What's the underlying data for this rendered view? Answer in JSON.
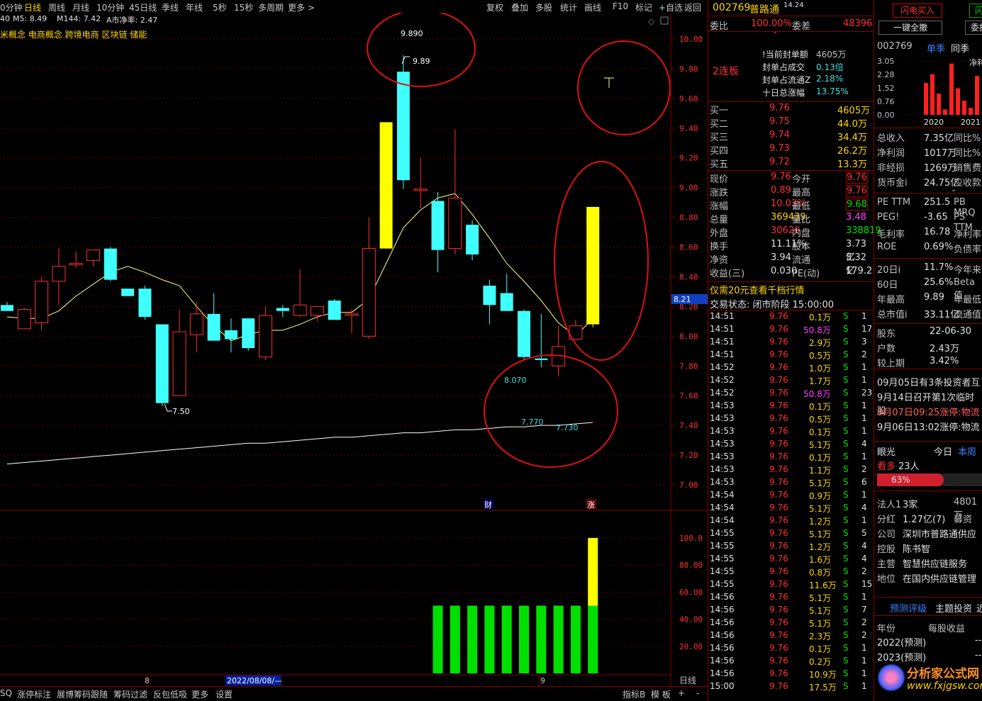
{
  "toolbar": {
    "periods": [
      "0分钟",
      "日线",
      "周线",
      "月线",
      "10分钟",
      "45日线",
      "季线",
      "年线",
      "5秒",
      "15秒",
      "多周期",
      "更多 >"
    ],
    "active": "日线",
    "right_tools": [
      "复权",
      "叠加",
      "多股",
      "统计",
      "画线",
      "F10",
      "标记",
      "+自选",
      "返回"
    ]
  },
  "indicator_line": {
    "prefix": "40",
    "ma5": "M5: 8.49",
    "ma144": "M144: 7.42",
    "net": "A市净率: 2.47"
  },
  "concepts": "米概念 电商概念 跨境电商 区块链 储能",
  "annotations": {
    "high_label": "9.890",
    "high_mark": "9.89",
    "low_mark": "7.50",
    "support_a": "8.070",
    "support_b": "7.770",
    "support_c": "7.730",
    "cur_price": "8.21",
    "event_fin": "财",
    "event_up": "涨"
  },
  "x_labels": [
    "8",
    "2022/08/08/—",
    "9"
  ],
  "right_axis_label": "日线",
  "chart_data": [
    {
      "type": "candlestick",
      "title": "",
      "ylim": [
        6.9,
        10.1
      ],
      "y_ticks": [
        "10.00",
        "9.80",
        "9.60",
        "9.40",
        "9.20",
        "9.00",
        "8.80",
        "8.60",
        "8.40",
        "8.20",
        "8.00",
        "7.80",
        "7.60",
        "7.40",
        "7.20",
        "7.00"
      ],
      "candles": [
        {
          "o": 8.21,
          "h": 8.23,
          "l": 8.17,
          "c": 8.17
        },
        {
          "o": 8.05,
          "h": 8.19,
          "l": 8.05,
          "c": 8.18
        },
        {
          "o": 8.09,
          "h": 8.4,
          "l": 8.04,
          "c": 8.37
        },
        {
          "o": 8.37,
          "h": 8.59,
          "l": 8.21,
          "c": 8.47
        },
        {
          "o": 8.48,
          "h": 8.57,
          "l": 8.46,
          "c": 8.49
        },
        {
          "o": 8.51,
          "h": 8.58,
          "l": 8.47,
          "c": 8.58
        },
        {
          "o": 8.59,
          "h": 8.6,
          "l": 8.37,
          "c": 8.38
        },
        {
          "o": 8.32,
          "h": 8.32,
          "l": 8.27,
          "c": 8.27
        },
        {
          "o": 8.32,
          "h": 8.34,
          "l": 8.11,
          "c": 8.13
        },
        {
          "o": 8.08,
          "h": 8.08,
          "l": 7.53,
          "c": 7.55
        },
        {
          "o": 7.6,
          "h": 8.18,
          "l": 7.6,
          "c": 8.03
        },
        {
          "o": 8.01,
          "h": 8.23,
          "l": 7.89,
          "c": 8.15
        },
        {
          "o": 8.15,
          "h": 8.29,
          "l": 7.98,
          "c": 7.97
        },
        {
          "o": 8.04,
          "h": 8.12,
          "l": 7.89,
          "c": 7.98
        },
        {
          "o": 8.12,
          "h": 8.12,
          "l": 7.9,
          "c": 7.92
        },
        {
          "o": 7.86,
          "h": 8.2,
          "l": 7.84,
          "c": 8.14
        },
        {
          "o": 8.19,
          "h": 8.21,
          "l": 8.13,
          "c": 8.17
        },
        {
          "o": 8.14,
          "h": 8.45,
          "l": 8.13,
          "c": 8.21
        },
        {
          "o": 8.14,
          "h": 8.17,
          "l": 8.1,
          "c": 8.2
        },
        {
          "o": 8.24,
          "h": 8.25,
          "l": 8.12,
          "c": 8.11
        },
        {
          "o": 8.15,
          "h": 8.18,
          "l": 8.02,
          "c": 8.15
        },
        {
          "o": 8.0,
          "h": 8.8,
          "l": 7.98,
          "c": 8.59
        },
        {
          "o": 8.59,
          "h": 9.44,
          "l": 8.59,
          "c": 9.44,
          "limit": true
        },
        {
          "o": 9.78,
          "h": 9.89,
          "l": 8.99,
          "c": 9.05
        },
        {
          "o": 8.99,
          "h": 9.2,
          "l": 8.86,
          "c": 8.99
        },
        {
          "o": 8.91,
          "h": 8.97,
          "l": 8.43,
          "c": 8.58
        },
        {
          "o": 8.59,
          "h": 9.39,
          "l": 8.55,
          "c": 8.93
        },
        {
          "o": 8.75,
          "h": 8.78,
          "l": 8.51,
          "c": 8.55
        },
        {
          "o": 8.34,
          "h": 8.38,
          "l": 8.08,
          "c": 8.21
        },
        {
          "o": 8.29,
          "h": 8.42,
          "l": 8.17,
          "c": 8.17
        },
        {
          "o": 8.17,
          "h": 8.18,
          "l": 7.84,
          "c": 7.86
        },
        {
          "o": 7.85,
          "h": 8.15,
          "l": 7.79,
          "c": 7.84
        },
        {
          "o": 7.8,
          "h": 8.07,
          "l": 7.73,
          "c": 7.93
        },
        {
          "o": 7.98,
          "h": 8.11,
          "l": 7.99,
          "c": 8.07
        },
        {
          "o": 8.08,
          "h": 8.87,
          "l": 8.06,
          "c": 8.87,
          "limit": true
        }
      ],
      "ma5": [
        8.13,
        8.12,
        8.12,
        8.17,
        8.27,
        8.35,
        8.43,
        8.47,
        8.43,
        8.38,
        8.34,
        8.2,
        8.07,
        7.97,
        8.01,
        8.04,
        8.04,
        8.08,
        8.13,
        8.16,
        8.16,
        8.25,
        8.49,
        8.73,
        8.85,
        8.93,
        8.96,
        8.82,
        8.66,
        8.49,
        8.37,
        8.24,
        8.09,
        8.0,
        8.12
      ],
      "ma144": [
        7.14,
        7.15,
        7.16,
        7.17,
        7.18,
        7.19,
        7.2,
        7.21,
        7.22,
        7.23,
        7.24,
        7.25,
        7.26,
        7.27,
        7.28,
        7.28,
        7.29,
        7.3,
        7.31,
        7.32,
        7.32,
        7.33,
        7.34,
        7.35,
        7.35,
        7.36,
        7.37,
        7.37,
        7.38,
        7.39,
        7.39,
        7.4,
        7.4,
        7.41,
        7.42
      ]
    },
    {
      "type": "bar",
      "title": "",
      "ylim": [
        0,
        110
      ],
      "y_ticks": [
        "100.0",
        "80.00",
        "60.00",
        "40.00",
        "20.00"
      ],
      "values": [
        0,
        0,
        0,
        0,
        0,
        0,
        0,
        0,
        0,
        0,
        0,
        0,
        0,
        0,
        0,
        0,
        0,
        0,
        0,
        0,
        0,
        0,
        0,
        0,
        0,
        50,
        50,
        50,
        50,
        50,
        50,
        50,
        50,
        50,
        100
      ],
      "highlight_last": true
    },
    {
      "type": "bar",
      "title": "",
      "categories": [
        "2020",
        "2021"
      ],
      "y_ticks": [
        "3.05",
        "2.28",
        "1.52",
        "0.76",
        "0.00"
      ],
      "values": [
        1.8,
        2.3,
        1.2,
        0.3,
        2.9,
        1.5,
        0.8,
        0.4,
        2.2
      ]
    }
  ],
  "quote": {
    "code": "002769",
    "name": "普路通",
    "superscript": "14.24",
    "wb_label": "委比",
    "wb": "100.00%",
    "wc_label": "委差",
    "wc": "48396",
    "streak": "2连板",
    "seal": [
      {
        "k": "!当前封单额",
        "v": "4605万"
      },
      {
        "k": "封单占成交",
        "v": "0.13倍"
      },
      {
        "k": "封单占流通Z",
        "v": "2.18%"
      },
      {
        "k": "十日总涨幅",
        "v": "13.75%"
      }
    ],
    "bids": [
      {
        "k": "买一",
        "p": "9.76",
        "v": "4605万"
      },
      {
        "k": "买二",
        "p": "9.75",
        "v": "44.0万"
      },
      {
        "k": "买三",
        "p": "9.74",
        "v": "34.4万"
      },
      {
        "k": "买四",
        "p": "9.73",
        "v": "26.2万"
      },
      {
        "k": "买五",
        "p": "9.72",
        "v": "13.3万"
      }
    ],
    "stats": [
      {
        "k1": "现价",
        "v1": "9.76",
        "k2": "今开",
        "v2": "9.76"
      },
      {
        "k1": "涨跌",
        "v1": "0.89",
        "k2": "最高",
        "v2": "9.76"
      },
      {
        "k1": "涨幅",
        "v1": "10.03%",
        "k2": "最低",
        "v2": "9.68"
      },
      {
        "k1": "总量",
        "v1": "369439",
        "k2": "量比",
        "v2": "3.48"
      },
      {
        "k1": "外盘",
        "v1": "30620",
        "k2": "内盘",
        "v2": "338819"
      },
      {
        "k1": "换手",
        "v1": "11.11%",
        "k2": "股本",
        "v2": "3.73亿"
      },
      {
        "k1": "净资",
        "v1": "3.94",
        "k2": "流通",
        "v2": "3.32亿"
      },
      {
        "k1": "收益(三)",
        "v1": "0.030",
        "k2": "PE(动)",
        "v2": "179.2"
      }
    ],
    "promo": "仅需20元查看千档行情",
    "status": "交易状态: 闭市阶段 15:00:00",
    "ticks": [
      [
        "14:51",
        "9.76",
        "0.1万",
        "S",
        "1"
      ],
      [
        "14:51",
        "9.76",
        "50.8万",
        "S",
        "17"
      ],
      [
        "14:51",
        "9.76",
        "2.9万",
        "S",
        "3"
      ],
      [
        "14:51",
        "9.76",
        "0.5万",
        "S",
        "2"
      ],
      [
        "14:52",
        "9.76",
        "1.0万",
        "S",
        "1"
      ],
      [
        "14:52",
        "9.76",
        "1.7万",
        "S",
        "1"
      ],
      [
        "14:52",
        "9.76",
        "50.8万",
        "S",
        "23"
      ],
      [
        "14:53",
        "9.76",
        "0.1万",
        "S",
        "1"
      ],
      [
        "14:53",
        "9.76",
        "0.5万",
        "S",
        "1"
      ],
      [
        "14:53",
        "9.76",
        "0.1万",
        "S",
        "1"
      ],
      [
        "14:53",
        "9.76",
        "5.1万",
        "S",
        "4"
      ],
      [
        "14:53",
        "9.76",
        "0.1万",
        "S",
        "1"
      ],
      [
        "14:53",
        "9.76",
        "1.1万",
        "S",
        "2"
      ],
      [
        "14:53",
        "9.76",
        "5.1万",
        "S",
        "6"
      ],
      [
        "14:54",
        "9.76",
        "0.9万",
        "S",
        "1"
      ],
      [
        "14:54",
        "9.76",
        "5.1万",
        "S",
        "4"
      ],
      [
        "14:54",
        "9.76",
        "1.2万",
        "S",
        "1"
      ],
      [
        "14:55",
        "9.76",
        "5.1万",
        "S",
        "5"
      ],
      [
        "14:55",
        "9.76",
        "1.2万",
        "S",
        "4"
      ],
      [
        "14:55",
        "9.76",
        "1.6万",
        "S",
        "4"
      ],
      [
        "14:55",
        "9.76",
        "0.8万",
        "S",
        "2"
      ],
      [
        "14:55",
        "9.76",
        "11.6万",
        "S",
        "15"
      ],
      [
        "14:56",
        "9.76",
        "5.1万",
        "S",
        "1"
      ],
      [
        "14:56",
        "9.76",
        "5.1万",
        "S",
        "7"
      ],
      [
        "14:56",
        "9.76",
        "5.1万",
        "S",
        "2"
      ],
      [
        "14:56",
        "9.76",
        "2.3万",
        "S",
        "2"
      ],
      [
        "14:56",
        "9.76",
        "0.1万",
        "S",
        "1"
      ],
      [
        "14:56",
        "9.76",
        "0.2万",
        "S",
        "1"
      ],
      [
        "14:56",
        "9.76",
        "10.9万",
        "S",
        "1"
      ],
      [
        "15:00",
        "9.76",
        "17.5万",
        "S",
        "1"
      ]
    ]
  },
  "fin": {
    "btn_flash_buy": "闪电买入",
    "btn_flash_sell": "闪电",
    "btn_cancel_all": "一键全撤",
    "btn_order": "委托",
    "code": "002769",
    "tab_q": "单季",
    "tab_yoy": "同季",
    "netprofit": "净利",
    "rows1": [
      {
        "k": "总收入",
        "v": "7.35亿",
        "x": "同比%"
      },
      {
        "k": "净利润",
        "v": "1017万",
        "x": "同比%"
      },
      {
        "k": "非经损",
        "v": "1269万",
        "x": "销售费"
      },
      {
        "k": "货币金i",
        "v": "24.75亿",
        "x": "应收款"
      }
    ],
    "rows2": [
      {
        "k": "PE TTM",
        "v": "251.5",
        "x": "PB MRQ"
      },
      {
        "k": "PEG!",
        "v": "-3.65",
        "x": "PS TTM"
      },
      {
        "k": "毛利率",
        "v": "16.78",
        "x": "净利率"
      },
      {
        "k": "ROE",
        "v": "0.69%",
        "x": "负债率"
      }
    ],
    "rows3": [
      {
        "k": "20日i",
        "v": "11.7%",
        "x": "今年来"
      },
      {
        "k": "60日",
        "v": "25.6%",
        "x": "Beta值"
      },
      {
        "k": "年最高",
        "v": "9.89",
        "x": "年最低"
      },
      {
        "k": "总市值i",
        "v": "33.11亿",
        "x": "流通值"
      }
    ],
    "rows4": [
      {
        "k": "股东",
        "v": "22-06-30"
      },
      {
        "k": "户数",
        "v": "2.43万"
      },
      {
        "k": "较上期",
        "v": "3.42%"
      }
    ],
    "news": [
      "09月05日有3条投资者互",
      "9月14日召开第1次临时股",
      "9月07日09:25涨停:物流",
      "9月06日13:02涨停:物流"
    ],
    "eye": "眼光",
    "today": "今日",
    "week": "本周",
    "bull": "看多",
    "bull_n": "23人",
    "pct": "63%",
    "rows5": [
      {
        "k": "法人1",
        "v": "3家",
        "x": "4801万"
      },
      {
        "k": "分红",
        "v": "1.27亿(7)",
        "x": "募资"
      },
      {
        "k": "公司",
        "v": "深圳市普路通供应"
      },
      {
        "k": "控股",
        "v": "陈书智"
      },
      {
        "k": "主营",
        "v": "智慧供应链服务"
      },
      {
        "k": "地位",
        "v": "在国内供应链管理"
      }
    ],
    "tab_rating": "预测评级",
    "tab_theme": "主题投资",
    "tab_more": "近",
    "fc_head1": "年份",
    "fc_head2": "每股收益",
    "fc": [
      {
        "y": "2022(预测)",
        "v": "--"
      },
      {
        "y": "2023(预测)",
        "v": "--"
      }
    ],
    "watermark": "分析家公式网",
    "watermark_url": "www.fxjgsw.com"
  },
  "bottom": {
    "tabs": [
      "SQ",
      "涨停标注",
      "展博筹码跟随",
      "筹码过滤",
      "反包低吸",
      "更多",
      "设置"
    ],
    "right": [
      "指标B",
      "模 板",
      "+",
      "-"
    ]
  },
  "colors": {
    "limit": "#ffff00",
    "up": "#ff3030",
    "down": "#40ffff",
    "vol": "#00e000",
    "ma5": "#ffff80",
    "ma144": "#ffffff"
  }
}
